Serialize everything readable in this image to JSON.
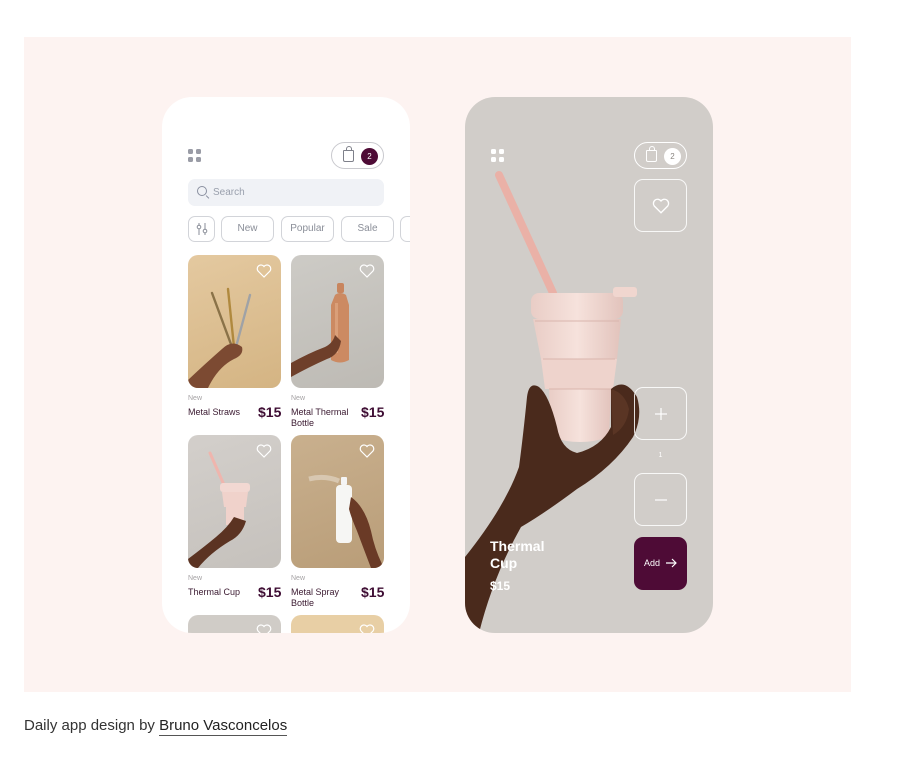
{
  "phone_list": {
    "cart_count": "2",
    "search_placeholder": "Search",
    "filters": [
      "New",
      "Popular",
      "Sale"
    ],
    "products": [
      {
        "tag": "New",
        "name": "Metal Straws",
        "price": "$15"
      },
      {
        "tag": "New",
        "name": "Metal Thermal Bottle",
        "price": "$15"
      },
      {
        "tag": "New",
        "name": "Thermal Cup",
        "price": "$15"
      },
      {
        "tag": "New",
        "name": "Metal Spray Bottle",
        "price": "$15"
      }
    ]
  },
  "phone_detail": {
    "cart_count": "2",
    "product_name": "Thermal Cup",
    "price": "$15",
    "quantity": "1",
    "add_label": "Add"
  },
  "caption": {
    "prefix": "Daily app design by",
    "author": "Bruno Vasconcelos"
  },
  "colors": {
    "accent": "#4e0b36",
    "background": "#fdf3f1"
  },
  "icons": [
    "grid-icon",
    "bag-icon",
    "search-icon",
    "filter-icon",
    "heart-icon",
    "plus-icon",
    "minus-icon",
    "arrow-right-icon"
  ]
}
